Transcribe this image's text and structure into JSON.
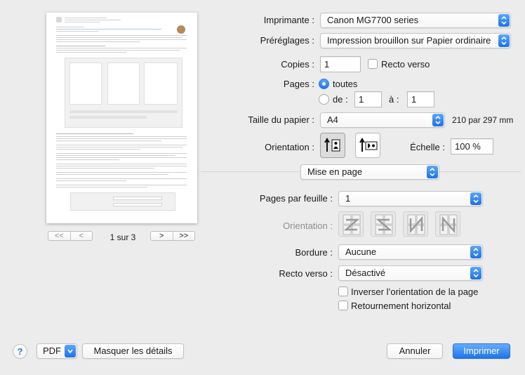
{
  "preview": {
    "page_indicator": "1 sur 3",
    "nav_first": "<<",
    "nav_prev": "<",
    "nav_next": ">",
    "nav_last": ">>"
  },
  "form": {
    "printer_label": "Imprimante :",
    "printer_value": "Canon MG7700 series",
    "presets_label": "Préréglages :",
    "presets_value": "Impression brouillon sur Papier ordinaire",
    "copies_label": "Copies :",
    "copies_value": "1",
    "duplex_label": "Recto verso",
    "pages_label": "Pages :",
    "pages_all": "toutes",
    "pages_from": "de :",
    "pages_from_value": "1",
    "pages_to": "à :",
    "pages_to_value": "1",
    "paper_size_label": "Taille du papier :",
    "paper_size_value": "A4",
    "paper_size_dims": "210 par 297 mm",
    "orientation_label": "Orientation :",
    "scale_label": "Échelle :",
    "scale_value": "100 %",
    "section_value": "Mise en page",
    "pages_per_sheet_label": "Pages par feuille :",
    "pages_per_sheet_value": "1",
    "layout_direction_label": "Orientation :",
    "border_label": "Bordure :",
    "border_value": "Aucune",
    "two_sided_label": "Recto verso :",
    "two_sided_value": "Désactivé",
    "reverse_orientation": "Inverser l’orientation de la page",
    "flip_horizontal": "Retournement horizontal"
  },
  "footer": {
    "help": "?",
    "pdf": "PDF",
    "hide_details": "Masquer les détails",
    "cancel": "Annuler",
    "print": "Imprimer"
  },
  "colors": {
    "accent": "#1e74ea",
    "window_bg": "#ececec"
  }
}
